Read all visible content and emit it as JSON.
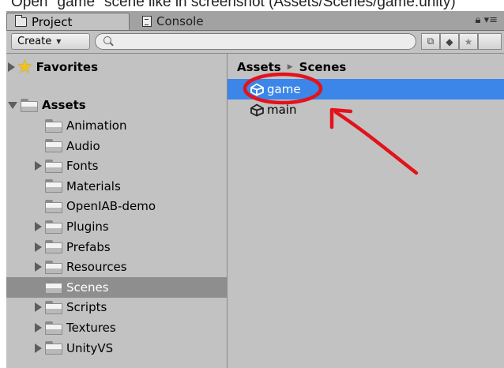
{
  "caption": "Open \"game\" scene like in screenshot (Assets/Scenes/game.unity)",
  "tabs": [
    {
      "label": "Project",
      "icon": "folder-icon"
    },
    {
      "label": "Console",
      "icon": "console-icon"
    }
  ],
  "toolbar": {
    "create_label": "Create",
    "search_placeholder": ""
  },
  "sidebar": {
    "favorites_label": "Favorites",
    "assets_label": "Assets",
    "folders": [
      {
        "label": "Animation",
        "expandable": false
      },
      {
        "label": "Audio",
        "expandable": false
      },
      {
        "label": "Fonts",
        "expandable": true
      },
      {
        "label": "Materials",
        "expandable": false
      },
      {
        "label": "OpenIAB-demo",
        "expandable": false
      },
      {
        "label": "Plugins",
        "expandable": true
      },
      {
        "label": "Prefabs",
        "expandable": true
      },
      {
        "label": "Resources",
        "expandable": true
      },
      {
        "label": "Scenes",
        "expandable": false,
        "selected": true
      },
      {
        "label": "Scripts",
        "expandable": true
      },
      {
        "label": "Textures",
        "expandable": true
      },
      {
        "label": "UnityVS",
        "expandable": true
      }
    ]
  },
  "breadcrumb": [
    "Assets",
    "Scenes"
  ],
  "files": [
    {
      "label": "game",
      "icon": "unity-scene-icon",
      "selected": true
    },
    {
      "label": "main",
      "icon": "unity-scene-icon",
      "selected": false
    }
  ],
  "colors": {
    "panel": "#c2c2c2",
    "selection_blue": "#3b86e8",
    "selection_grey": "#8e8e8e",
    "annotation_red": "#e3131b"
  }
}
